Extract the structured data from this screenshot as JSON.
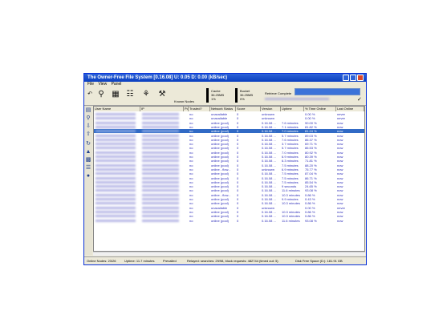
{
  "window": {
    "title": "The Owner-Free File System [0.16.08]   U:   0.05   D:   0.00  (kB/sec)"
  },
  "menu": [
    "File",
    "View",
    "Panel"
  ],
  "toolbar": {
    "known_nodes_label": "Known Nodes",
    "cache_label": "Cache",
    "cache_size": "36.25MB",
    "cache_percent": "1%",
    "bucket_label": "Bucket",
    "bucket_size": "36.25MB",
    "bucket_percent": "0%",
    "retrieve_label": "Retrieve Complete"
  },
  "table": {
    "columns": [
      "User Name",
      "IP",
      "Port",
      "Trusted?",
      "Network Status",
      "Score",
      "Version",
      "Uptime",
      "% Time Online",
      "Last Online"
    ],
    "rows": [
      {
        "trusted": "no",
        "status": "unavailable",
        "score": "0",
        "version": "unknown",
        "uptime": "",
        "pct": "0.00 %",
        "last": "never"
      },
      {
        "trusted": "no",
        "status": "unavailable",
        "score": "0",
        "version": "unknown",
        "uptime": "",
        "pct": "0.00 %",
        "last": "never"
      },
      {
        "trusted": "no",
        "status": "online (pool)",
        "score": "0",
        "version": "0.16.08 ...",
        "uptime": "7.6 minutes",
        "pct": "90.00 %",
        "last": "now"
      },
      {
        "trusted": "no",
        "status": "online (pool)",
        "score": "0",
        "version": "0.16.08 ...",
        "uptime": "7.1 minutes",
        "pct": "81.82 %",
        "last": "now"
      },
      {
        "trusted": "no",
        "status": "online (pool)",
        "score": "0",
        "version": "0.16.08 ...",
        "uptime": "7.0 minutes",
        "pct": "81.24 %",
        "last": "now",
        "selected": true
      },
      {
        "trusted": "no",
        "status": "online (pool)",
        "score": "0",
        "version": "0.16.08 ...",
        "uptime": "5.7 minutes",
        "pct": "89.03 %",
        "last": "now"
      },
      {
        "trusted": "no",
        "status": "online (pool)",
        "score": "0",
        "version": "0.16.08 ...",
        "uptime": "7.6 minutes",
        "pct": "86.37 %",
        "last": "now"
      },
      {
        "trusted": "no",
        "status": "online (pool)",
        "score": "0",
        "version": "0.16.08 ...",
        "uptime": "3.7 minutes",
        "pct": "69.71 %",
        "last": "now"
      },
      {
        "trusted": "no",
        "status": "online (pool)",
        "score": "0",
        "version": "0.16.08 ...",
        "uptime": "5.7 minutes",
        "pct": "86.53 %",
        "last": "now"
      },
      {
        "trusted": "no",
        "status": "online (pool)",
        "score": "0",
        "version": "0.16.08 ...",
        "uptime": "7.0 minutes",
        "pct": "80.92 %",
        "last": "now"
      },
      {
        "trusted": "no",
        "status": "online (pool)",
        "score": "0",
        "version": "0.16.08 ...",
        "uptime": "6.9 minutes",
        "pct": "80.39 %",
        "last": "now"
      },
      {
        "trusted": "no",
        "status": "online (pool)",
        "score": "0",
        "version": "0.16.08 ...",
        "uptime": "6.3 minutes",
        "pct": "71.81 %",
        "last": "now"
      },
      {
        "trusted": "no",
        "status": "online (pool)",
        "score": "0",
        "version": "0.16.08 ...",
        "uptime": "7.5 minutes",
        "pct": "88.20 %",
        "last": "now"
      },
      {
        "trusted": "no",
        "status": "online - flow...",
        "score": "0",
        "version": "unknown",
        "uptime": "6.9 minutes",
        "pct": "75.77 %",
        "last": "now"
      },
      {
        "trusted": "no",
        "status": "online (pool)",
        "score": "0",
        "version": "0.16.08 ...",
        "uptime": "7.5 minutes",
        "pct": "87.04 %",
        "last": "now"
      },
      {
        "trusted": "no",
        "status": "online (pool)",
        "score": "0",
        "version": "0.16.08 ...",
        "uptime": "7.5 minutes",
        "pct": "86.71 %",
        "last": "now"
      },
      {
        "trusted": "no",
        "status": "online (pool)",
        "score": "0",
        "version": "0.16.08 ...",
        "uptime": "7.5 minutes",
        "pct": "85.54 %",
        "last": "now"
      },
      {
        "trusted": "no",
        "status": "online (pool)",
        "score": "0",
        "version": "0.16.08 ...",
        "uptime": "9 seconds",
        "pct": "24.65 %",
        "last": "now"
      },
      {
        "trusted": "no",
        "status": "online (pool)",
        "score": "0",
        "version": "0.16.08 ...",
        "uptime": "11.6 minutes",
        "pct": "93.08 %",
        "last": "now"
      },
      {
        "trusted": "no",
        "status": "online - flow...",
        "score": "0",
        "version": "0.16.08 ...",
        "uptime": "10.3 minutes",
        "pct": "0.86 %",
        "last": "now"
      },
      {
        "trusted": "no",
        "status": "online (pool)",
        "score": "0",
        "version": "0.16.08 ...",
        "uptime": "9.9 minutes",
        "pct": "0.43 %",
        "last": "now"
      },
      {
        "trusted": "no",
        "status": "online (pool)",
        "score": "0",
        "version": "0.16.08 ...",
        "uptime": "10.3 minutes",
        "pct": "0.86 %",
        "last": "now"
      },
      {
        "trusted": "no",
        "status": "unavailable",
        "score": "0",
        "version": "unknown",
        "uptime": "",
        "pct": "0.00 %",
        "last": "never"
      },
      {
        "trusted": "no",
        "status": "online (pool)",
        "score": "0",
        "version": "0.16.08 ...",
        "uptime": "10.3 minutes",
        "pct": "0.86 %",
        "last": "now"
      },
      {
        "trusted": "no",
        "status": "online (pool)",
        "score": "0",
        "version": "0.16.08 ...",
        "uptime": "10.3 minutes",
        "pct": "0.86 %",
        "last": "now"
      },
      {
        "trusted": "no",
        "status": "online (pool)",
        "score": "0",
        "version": "0.16.08 ...",
        "uptime": "11.6 minutes",
        "pct": "93.08 %",
        "last": "now"
      }
    ]
  },
  "status_bar": {
    "online_nodes": "Online Nodes: 23/26",
    "uptime": "Uptime: 11.7 minutes",
    "prevalled": "Prevalled",
    "relayed": "Relayed: searches: 29/98,  block requests: 482744 (timed out: 5)",
    "disk_free": "Disk Free Space (D:): 181.91 GB"
  },
  "colors": {
    "title_bar": "#0a3fbf",
    "selected_row": "#316ac5",
    "row_text": "#2a2ab8",
    "progress": "#3b73d9"
  }
}
